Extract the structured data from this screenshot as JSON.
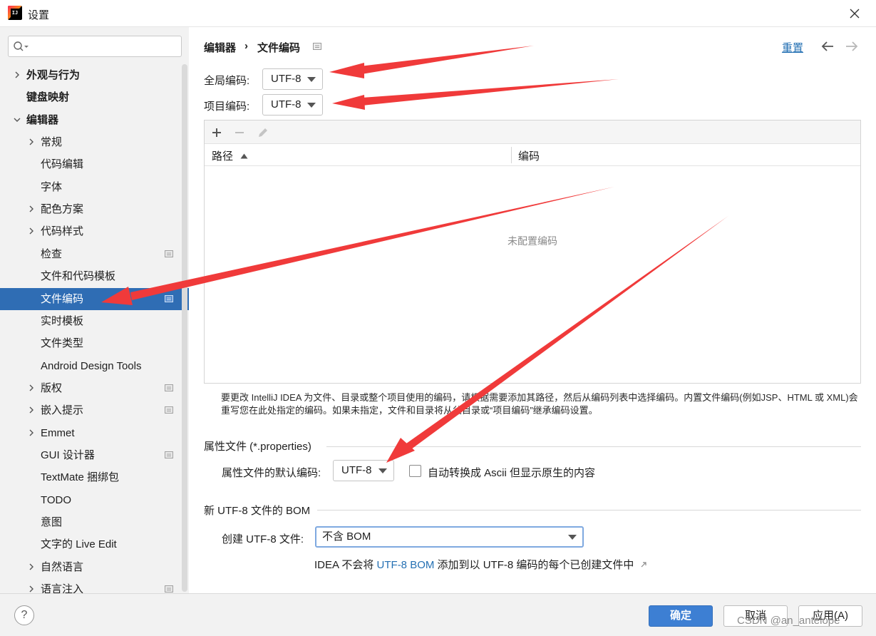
{
  "window": {
    "title": "设置"
  },
  "sidebar": {
    "items": [
      {
        "label": "外观与行为",
        "bold": true,
        "chevron": "right"
      },
      {
        "label": "键盘映射",
        "bold": true,
        "chevron": ""
      },
      {
        "label": "编辑器",
        "bold": true,
        "chevron": "down"
      },
      {
        "label": "常规",
        "chevron": "right"
      },
      {
        "label": "代码编辑",
        "chevron": ""
      },
      {
        "label": "字体",
        "chevron": ""
      },
      {
        "label": "配色方案",
        "chevron": "right"
      },
      {
        "label": "代码样式",
        "chevron": "right"
      },
      {
        "label": "检查",
        "chevron": "",
        "project_icon": true
      },
      {
        "label": "文件和代码模板",
        "chevron": ""
      },
      {
        "label": "文件编码",
        "chevron": "",
        "project_icon": true,
        "selected": true
      },
      {
        "label": "实时模板",
        "chevron": ""
      },
      {
        "label": "文件类型",
        "chevron": ""
      },
      {
        "label": "Android Design Tools",
        "chevron": ""
      },
      {
        "label": "版权",
        "chevron": "right",
        "project_icon": true
      },
      {
        "label": "嵌入提示",
        "chevron": "right",
        "project_icon": true
      },
      {
        "label": "Emmet",
        "chevron": "right"
      },
      {
        "label": "GUI 设计器",
        "chevron": "",
        "project_icon": true
      },
      {
        "label": "TextMate 捆绑包",
        "chevron": ""
      },
      {
        "label": "TODO",
        "chevron": ""
      },
      {
        "label": "意图",
        "chevron": ""
      },
      {
        "label": "文字的 Live Edit",
        "chevron": ""
      },
      {
        "label": "自然语言",
        "chevron": "right"
      },
      {
        "label": "语言注入",
        "chevron": "right",
        "project_icon": true
      }
    ]
  },
  "breadcrumb": {
    "parent": "编辑器",
    "separator": "›",
    "current": "文件编码"
  },
  "header": {
    "reset_label": "重置"
  },
  "encoding": {
    "global_label": "全局编码:",
    "global_value": "UTF-8",
    "project_label": "项目编码:",
    "project_value": "UTF-8"
  },
  "table": {
    "col_path": "路径",
    "col_encoding": "编码",
    "empty_text": "未配置编码"
  },
  "help_text": "要更改 IntelliJ IDEA 为文件、目录或整个项目使用的编码，请根据需要添加其路径，然后从编码列表中选择编码。内置文件编码(例如JSP、HTML 或 XML)会重写您在此处指定的编码。如果未指定，文件和目录将从父目录或“项目编码”继承编码设置。",
  "properties": {
    "section_title": "属性文件 (*.properties)",
    "default_label": "属性文件的默认编码:",
    "default_value": "UTF-8",
    "ascii_checkbox_label": "自动转换成 Ascii 但显示原生的内容",
    "ascii_checked": false
  },
  "bom": {
    "section_title": "新 UTF-8 文件的 BOM",
    "create_label": "创建 UTF-8 文件:",
    "create_value": "不含 BOM",
    "note_prefix": "IDEA 不会将",
    "note_link": "UTF-8 BOM",
    "note_suffix": "添加到以 UTF-8 编码的每个已创建文件中"
  },
  "footer": {
    "ok_label": "确定",
    "cancel_label": "取消",
    "apply_label": "应用(A)"
  },
  "watermark": "CSDN @an_antelope",
  "colors": {
    "accent": "#2f6db4",
    "link": "#2470b3",
    "annotation_arrow": "#f03a3a"
  }
}
